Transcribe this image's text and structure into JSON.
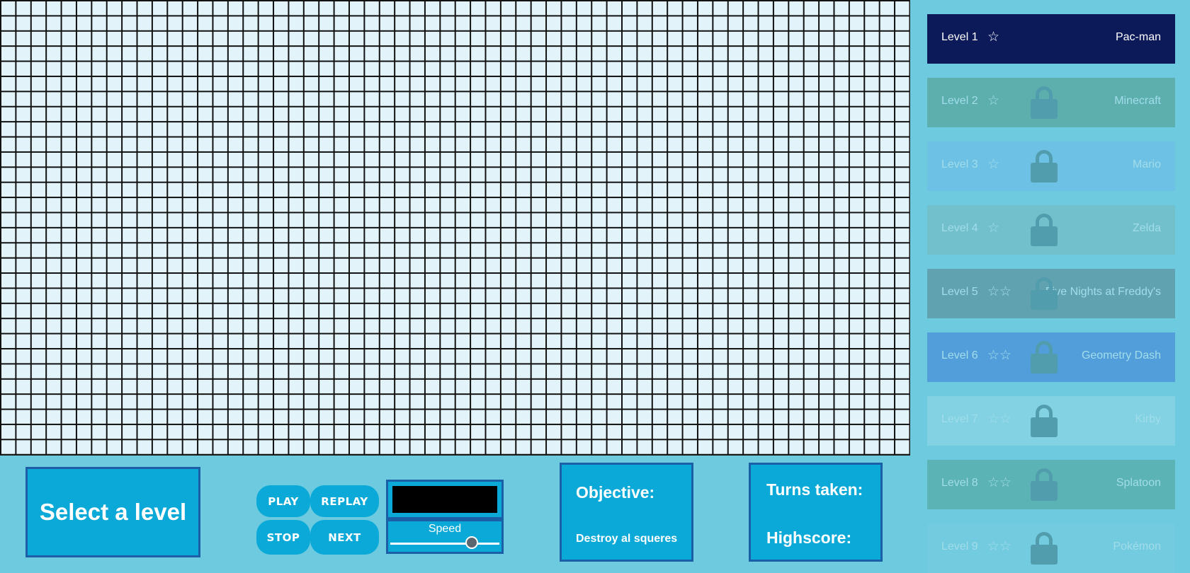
{
  "bottom": {
    "select_level": "Select a level",
    "play": "PLAY",
    "replay": "REPLAY",
    "stop": "STOP",
    "next": "NEXT",
    "speed_label": "Speed",
    "speed_value": 0.78,
    "objective_title": "Objective:",
    "objective_text": "Destroy al squeres",
    "turns_label": "Turns taken:",
    "highscore_label": "Highscore:"
  },
  "levels": [
    {
      "label": "Level 1",
      "stars": "☆",
      "name": "Pac-man",
      "locked": false,
      "theme": "#0d1a5a"
    },
    {
      "label": "Level 2",
      "stars": "☆",
      "name": "Minecraft",
      "locked": true,
      "theme": "#3f7f55"
    },
    {
      "label": "Level 3",
      "stars": "☆",
      "name": "Mario",
      "locked": true,
      "theme": "#6cb2f0"
    },
    {
      "label": "Level 4",
      "stars": "☆",
      "name": "Zelda",
      "locked": true,
      "theme": "#7ab0a8"
    },
    {
      "label": "Level 5",
      "stars": "☆☆",
      "name": "Five Nights at Freddy's",
      "locked": true,
      "theme": "#4a5a5a"
    },
    {
      "label": "Level 6",
      "stars": "☆☆",
      "name": "Geometry Dash",
      "locked": true,
      "theme": "#1c4fd6"
    },
    {
      "label": "Level 7",
      "stars": "☆☆",
      "name": "Kirby",
      "locked": true,
      "theme": "#a7e3f0"
    },
    {
      "label": "Level 8",
      "stars": "☆☆",
      "name": "Splatoon",
      "locked": true,
      "theme": "#3d8a6a"
    },
    {
      "label": "Level 9",
      "stars": "☆☆",
      "name": "Pokémon",
      "locked": true,
      "theme": "#7fcfdf"
    }
  ]
}
